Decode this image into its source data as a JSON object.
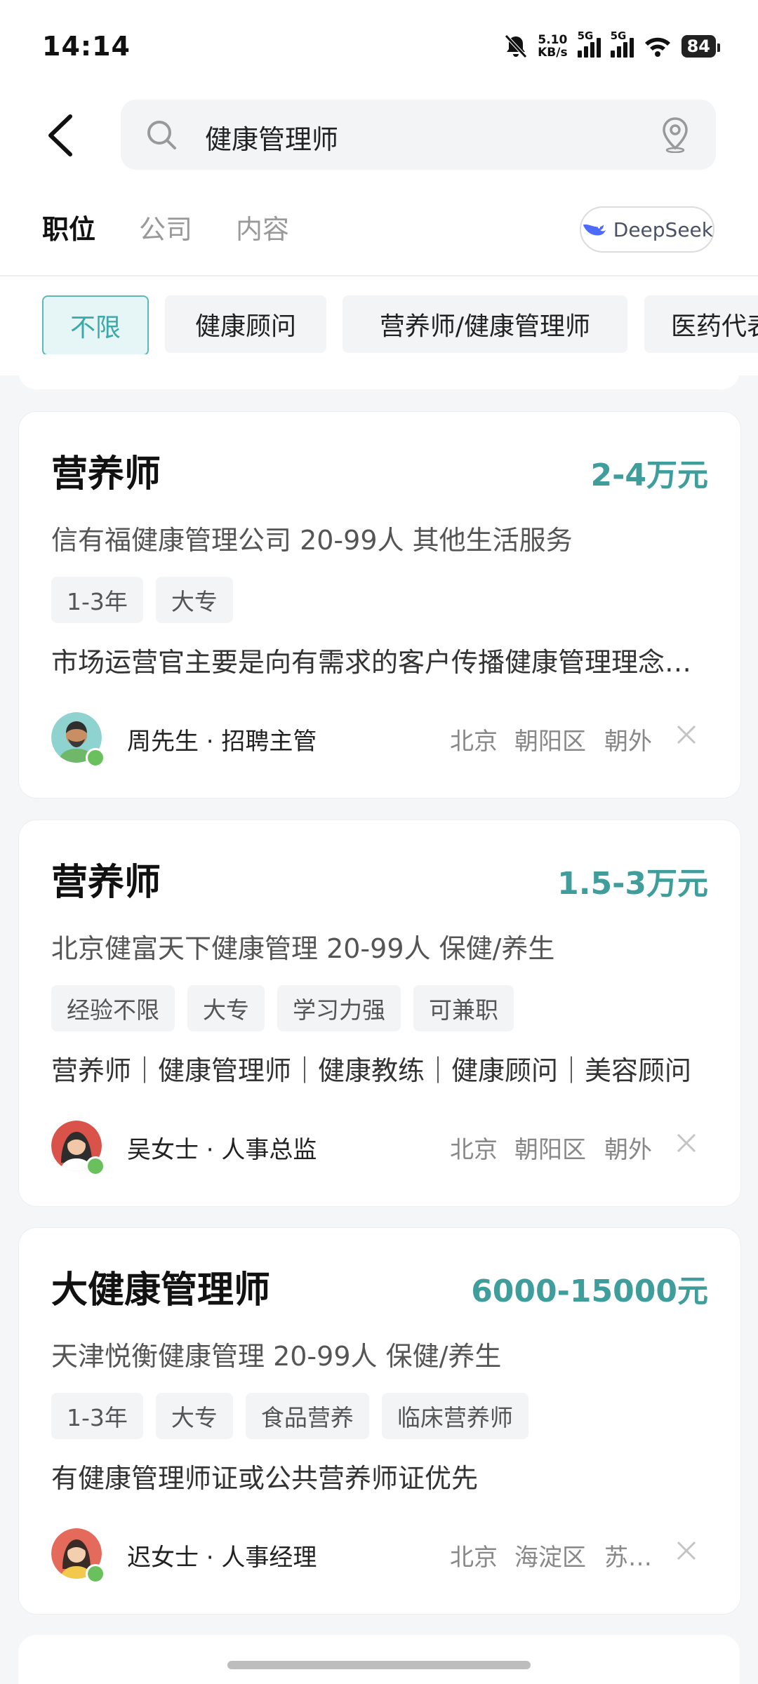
{
  "status_bar": {
    "time": "14:14",
    "net_speed_value": "5.10",
    "net_speed_unit": "KB/s",
    "signal1": "5G",
    "signal2": "5G",
    "battery": "84"
  },
  "search": {
    "query": "健康管理师"
  },
  "tabs": [
    {
      "label": "职位",
      "active": true
    },
    {
      "label": "公司",
      "active": false
    },
    {
      "label": "内容",
      "active": false
    }
  ],
  "deepseek": {
    "label": "DeepSeek",
    "color": "#4d6bfe"
  },
  "filters": [
    {
      "label": "不限",
      "selected": true
    },
    {
      "label": "健康顾问",
      "selected": false
    },
    {
      "label": "营养师/健康管理师",
      "selected": false
    },
    {
      "label": "医药代表",
      "selected": false
    }
  ],
  "accent_color": "#3f9d9c",
  "jobs": [
    {
      "title": "营养师",
      "salary": "2-4万元",
      "company": "信有福健康管理公司  20-99人  其他生活服务",
      "tags": [
        "1-3年",
        "大专"
      ],
      "desc": "市场运营官主要是向有需求的客户传播健康管理理念，提供健康咨询服务",
      "recruiter": "周先生 · 招聘主管",
      "location": {
        "city": "北京",
        "district": "朝阳区",
        "area": "朝外"
      }
    },
    {
      "title": "营养师",
      "salary": "1.5-3万元",
      "company": "北京健富天下健康管理  20-99人  保健/养生",
      "tags": [
        "经验不限",
        "大专",
        "学习力强",
        "可兼职"
      ],
      "desc": "营养师｜健康管理师｜健康教练｜健康顾问｜美容顾问",
      "recruiter": "吴女士 · 人事总监",
      "location": {
        "city": "北京",
        "district": "朝阳区",
        "area": "朝外"
      }
    },
    {
      "title": "大健康管理师",
      "salary": "6000-15000元",
      "company": "天津悦衡健康管理  20-99人  保健/养生",
      "tags": [
        "1-3年",
        "大专",
        "食品营养",
        "临床营养师"
      ],
      "desc": "有健康管理师证或公共营养师证优先",
      "recruiter": "迟女士 · 人事经理",
      "location": {
        "city": "北京",
        "district": "海淀区",
        "area": "苏…"
      }
    }
  ]
}
